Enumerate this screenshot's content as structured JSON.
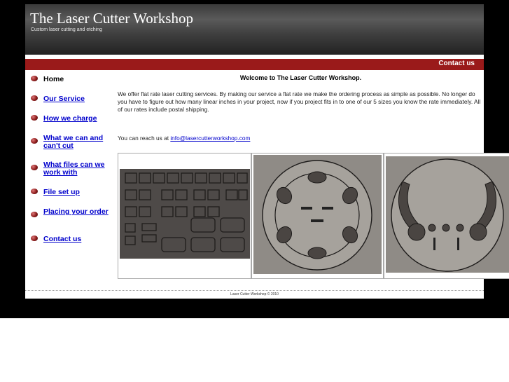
{
  "header": {
    "title": "The Laser Cutter Workshop",
    "tagline": "Custom laser cutting and etching"
  },
  "topnav": {
    "contact_label": "Contact us"
  },
  "sidebar": {
    "items": [
      {
        "label": "Home"
      },
      {
        "label": "Our Service"
      },
      {
        "label": "How we charge"
      },
      {
        "label": "What we can and can't cut"
      },
      {
        "label": "What files can we work with"
      },
      {
        "label": "File set up"
      },
      {
        "label": "Placing your order"
      },
      {
        "label": "Contact us"
      }
    ]
  },
  "main": {
    "heading": "Welcome to The Laser Cutter Workshop.",
    "intro": "We offer flat rate laser cutting services. By making our service a flat rate we make the ordering process as simple as possible. No longer do you have to figure out how many linear inches in your project, now if you project fits in to one of our 5 sizes you know the rate immediately. All of our rates include postal shipping.",
    "contact_prefix": "You can reach us at ",
    "contact_email": "info@lasercutterworkshop.com"
  },
  "footer": {
    "text": "Laser Cutter Workshop © 2010"
  },
  "colors": {
    "accent": "#9a1a1a",
    "link": "#0000cc",
    "header_dark": "#222222"
  }
}
